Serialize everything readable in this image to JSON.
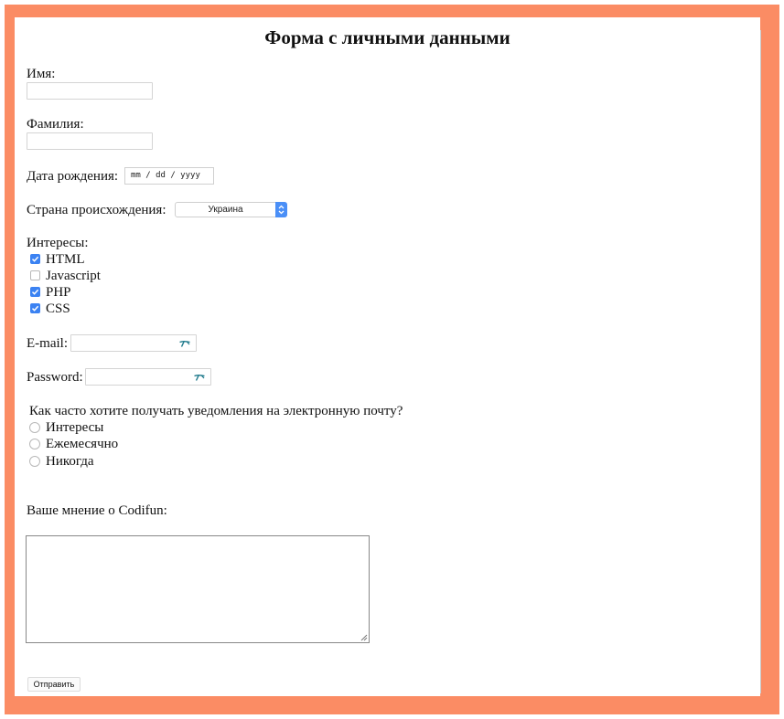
{
  "form": {
    "title": "Форма с личными данными",
    "first_name": {
      "label": "Имя:",
      "value": ""
    },
    "last_name": {
      "label": "Фамилия:",
      "value": ""
    },
    "birth_date": {
      "label": "Дата рождения:",
      "value": "mm / dd / yyyy"
    },
    "country": {
      "label": "Страна происхождения:",
      "selected": "Украина"
    },
    "interests": {
      "label": "Интересы:",
      "options": [
        {
          "label": "HTML",
          "checked": true
        },
        {
          "label": "Javascript",
          "checked": false
        },
        {
          "label": "PHP",
          "checked": true
        },
        {
          "label": "CSS",
          "checked": true
        }
      ]
    },
    "email": {
      "label": "E-mail:",
      "value": "",
      "icon": "key-icon"
    },
    "password": {
      "label": "Password:",
      "value": "",
      "icon": "key-icon"
    },
    "frequency": {
      "question": "Как часто хотите получать уведомления на электронную почту?",
      "options": [
        {
          "label": "Интересы",
          "selected": false
        },
        {
          "label": "Ежемесячно",
          "selected": false
        },
        {
          "label": "Никогда",
          "selected": false
        }
      ]
    },
    "opinion": {
      "label": "Ваше мнение о Codifun:",
      "value": ""
    },
    "submit_label": "Отправить"
  },
  "colors": {
    "frame": "#fb8c64",
    "accent": "#3b82f2"
  }
}
